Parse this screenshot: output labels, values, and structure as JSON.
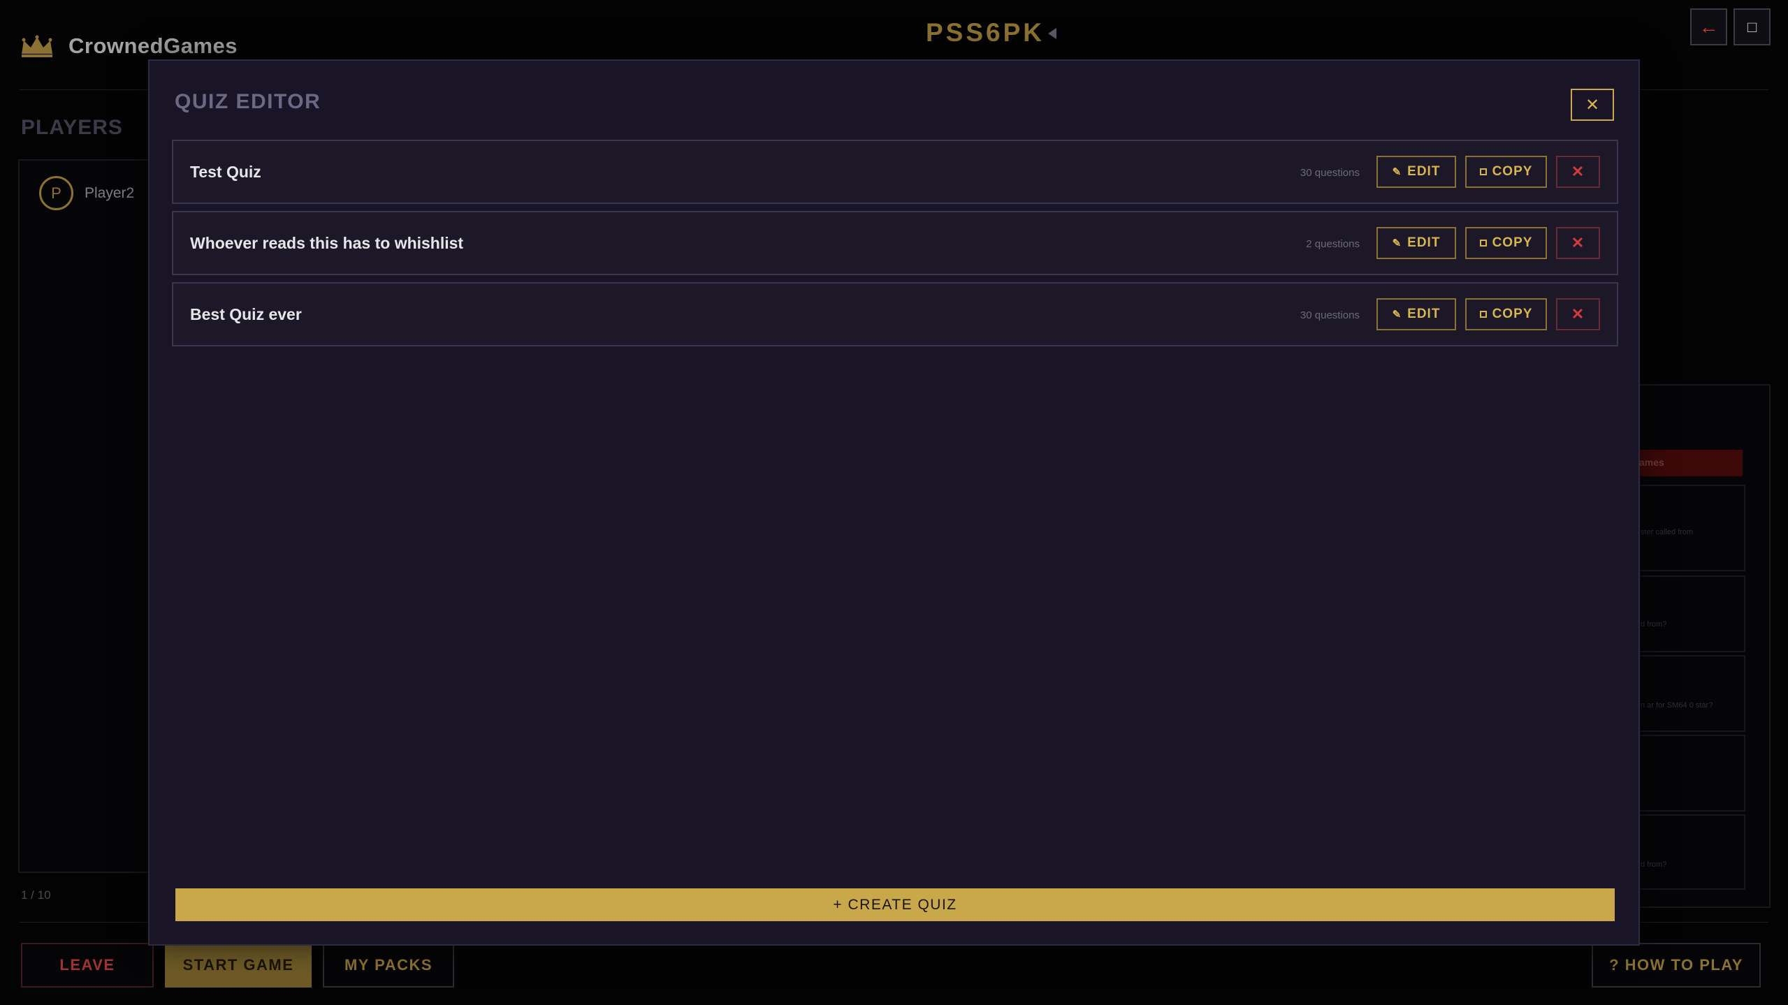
{
  "header": {
    "brand": "CrownedGames",
    "room_code": "PSS6PK"
  },
  "players": {
    "title": "PLAYERS",
    "list": [
      {
        "initial": "P",
        "name": "Player2"
      }
    ],
    "count": "1 / 10"
  },
  "bottom_bar": {
    "leave": "LEAVE",
    "start_game": "START GAME",
    "my_packs": "MY PACKS",
    "how_to_play": "? HOW TO PLAY"
  },
  "background_panel": {
    "tag": "ames",
    "card_texts": [
      "ster called from",
      "d from?",
      "n ar for SM64 0 star?",
      "",
      "d from?"
    ]
  },
  "modal": {
    "title": "QUIZ EDITOR",
    "close_glyph": "✕",
    "quizzes": [
      {
        "name": "Test Quiz",
        "count": "30 questions"
      },
      {
        "name": "Whoever reads this has to whishlist",
        "count": "2 questions"
      },
      {
        "name": "Best Quiz ever",
        "count": "30 questions"
      }
    ],
    "edit_label": "EDIT",
    "copy_label": "COPY",
    "delete_glyph": "✕",
    "create_label": "+ CREATE QUIZ"
  },
  "icons": {
    "accent": "#c9a84c",
    "danger": "#d33a3a",
    "modal_bg": "#191526"
  }
}
